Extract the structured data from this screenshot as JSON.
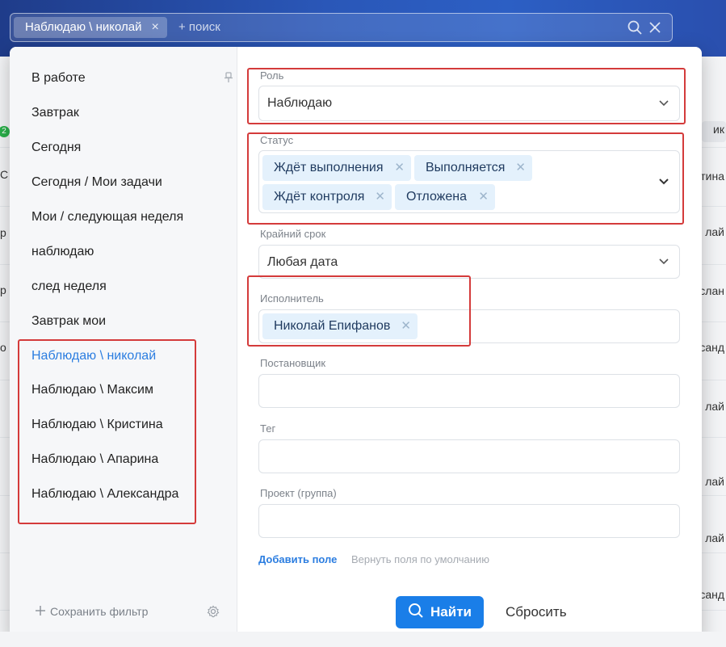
{
  "search": {
    "active_chip": "Наблюдаю \\ николай",
    "chip_close": "×",
    "placeholder": "+ поиск"
  },
  "background": {
    "badge": "2",
    "left_fragments": [
      "С",
      "р",
      "р",
      "о"
    ],
    "right_fragments": [
      "ик",
      "тина",
      "лай",
      "ислан",
      "санд",
      "лай",
      "лай",
      "лай",
      "санд"
    ]
  },
  "sidebar": {
    "items": [
      {
        "label": "В работе"
      },
      {
        "label": "Завтрак"
      },
      {
        "label": "Сегодня"
      },
      {
        "label": "Сегодня / Мои задачи"
      },
      {
        "label": "Мои / следующая неделя"
      },
      {
        "label": "наблюдаю"
      },
      {
        "label": "след неделя"
      },
      {
        "label": "Завтрак мои"
      },
      {
        "label": "Наблюдаю \\ николай"
      },
      {
        "label": "Наблюдаю \\ Максим"
      },
      {
        "label": "Наблюдаю \\ Кристина"
      },
      {
        "label": "Наблюдаю \\ Апарина"
      },
      {
        "label": "Наблюдаю \\ Александра"
      }
    ],
    "save_filter": "Сохранить фильтр"
  },
  "fields": {
    "role": {
      "label": "Роль",
      "value": "Наблюдаю"
    },
    "status": {
      "label": "Статус",
      "tags": [
        "Ждёт выполнения",
        "Выполняется",
        "Ждёт контроля",
        "Отложена"
      ]
    },
    "deadline": {
      "label": "Крайний срок",
      "value": "Любая дата"
    },
    "assignee": {
      "label": "Исполнитель",
      "tags": [
        "Николай Епифанов"
      ]
    },
    "creator": {
      "label": "Постановщик"
    },
    "tag": {
      "label": "Тег"
    },
    "project": {
      "label": "Проект (группа)"
    }
  },
  "actions": {
    "add_field": "Добавить поле",
    "restore_fields": "Вернуть поля по умолчанию",
    "find": "Найти",
    "reset": "Сбросить"
  },
  "colors": {
    "accent": "#1a7ee8",
    "highlight_border": "#d43b3b",
    "tag_bg": "#e4f1fc"
  }
}
